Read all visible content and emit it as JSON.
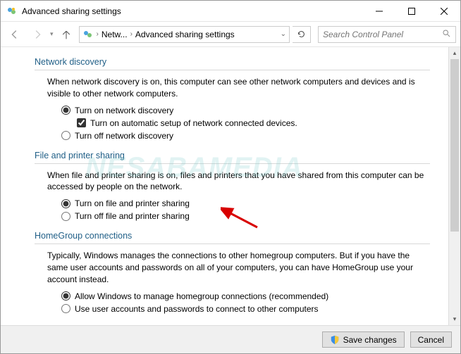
{
  "window": {
    "title": "Advanced sharing settings"
  },
  "nav": {
    "crumb1": "Netw...",
    "crumb2": "Advanced sharing settings",
    "search_placeholder": "Search Control Panel"
  },
  "sections": {
    "network_discovery": {
      "title": "Network discovery",
      "desc": "When network discovery is on, this computer can see other network computers and devices and is visible to other network computers.",
      "opt_on": "Turn on network discovery",
      "opt_auto": "Turn on automatic setup of network connected devices.",
      "opt_off": "Turn off network discovery"
    },
    "file_printer": {
      "title": "File and printer sharing",
      "desc": "When file and printer sharing is on, files and printers that you have shared from this computer can be accessed by people on the network.",
      "opt_on": "Turn on file and printer sharing",
      "opt_off": "Turn off file and printer sharing"
    },
    "homegroup": {
      "title": "HomeGroup connections",
      "desc": "Typically, Windows manages the connections to other homegroup computers. But if you have the same user accounts and passwords on all of your computers, you can have HomeGroup use your account instead.",
      "opt_allow": "Allow Windows to manage homegroup connections (recommended)",
      "opt_user": "Use user accounts and passwords to connect to other computers"
    }
  },
  "footer": {
    "save": "Save changes",
    "cancel": "Cancel"
  },
  "watermark": {
    "main": "NESABAMEDIA"
  }
}
